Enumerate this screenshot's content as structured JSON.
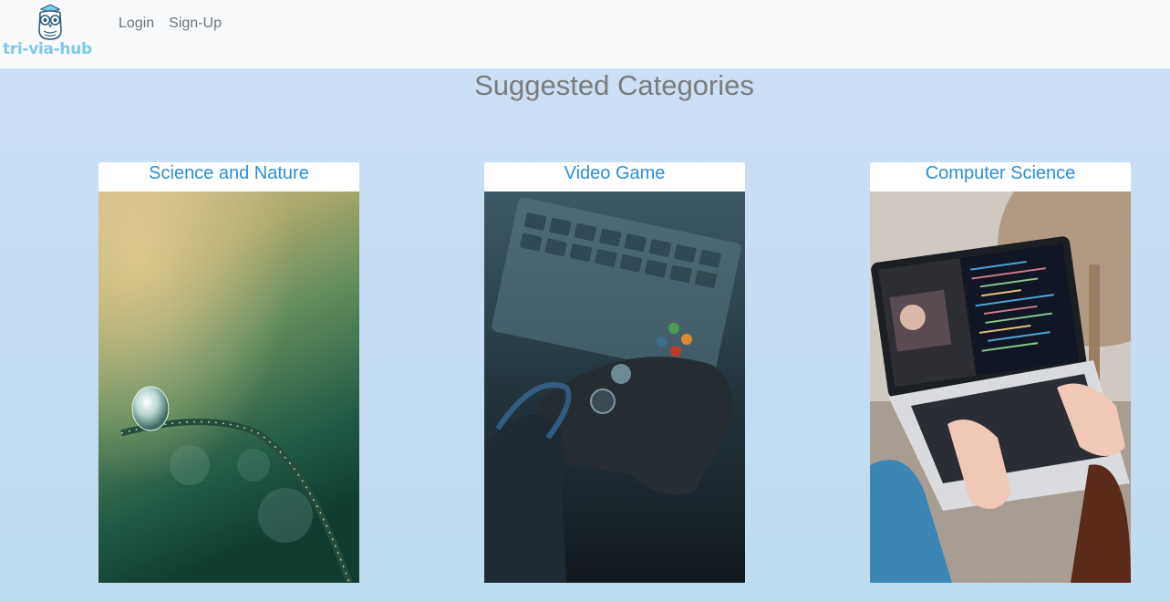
{
  "navbar": {
    "brand_name": "tri-via-hub",
    "links": [
      {
        "label": "Login"
      },
      {
        "label": "Sign-Up"
      }
    ]
  },
  "main": {
    "title": "Suggested Categories",
    "categories": [
      {
        "title": "Science and Nature",
        "image_subject": "water droplet on grass blade"
      },
      {
        "title": "Video Game",
        "image_subject": "hand holding game controller"
      },
      {
        "title": "Computer Science",
        "image_subject": "person typing on laptop with code"
      }
    ]
  },
  "colors": {
    "navbar_bg": "#f8f9fa",
    "page_bg": "#cfe0f5",
    "brand": "#7ec8ea",
    "link": "#6c757d",
    "card_title": "#2b8fd6",
    "page_title": "#7b7b7b"
  }
}
